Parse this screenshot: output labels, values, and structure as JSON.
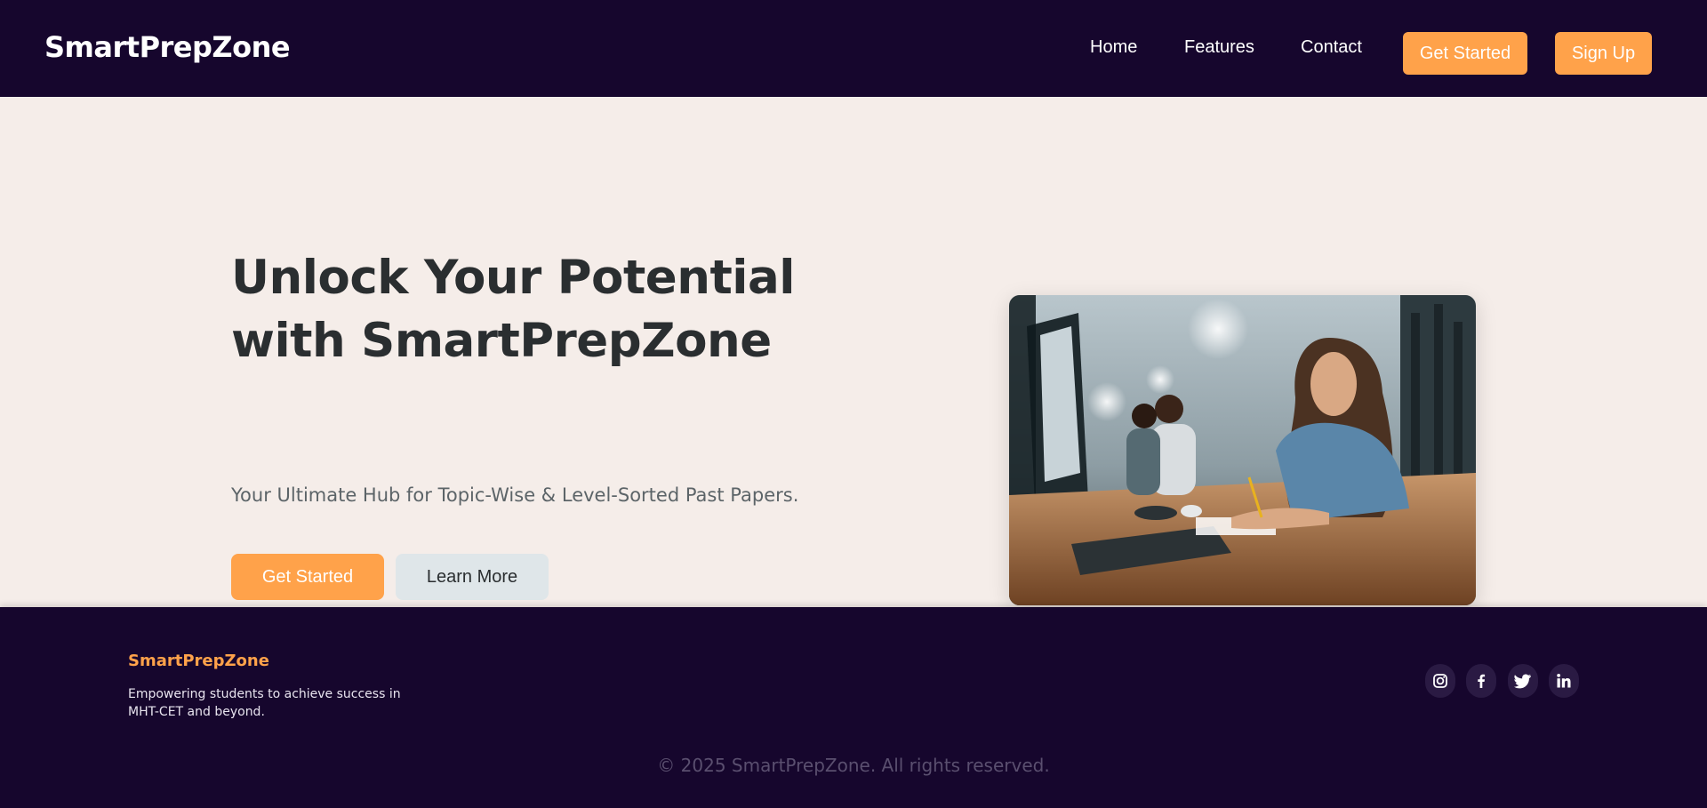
{
  "navbar": {
    "brand": "SmartPrepZone",
    "links": [
      "Home",
      "Features",
      "Contact"
    ],
    "get_started_label": "Get Started",
    "sign_up_label": "Sign Up"
  },
  "hero": {
    "title": "Unlock Your Potential with SmartPrepZone",
    "subtitle": "Your Ultimate Hub for Topic-Wise & Level-Sorted Past Papers.",
    "primary_label": "Get Started",
    "secondary_label": "Learn More",
    "image_icon": "students-studying-photo"
  },
  "footer": {
    "brand": "SmartPrepZone",
    "tagline": "Empowering students to achieve success in MHT-CET and beyond.",
    "social_icons": [
      "instagram-icon",
      "facebook-icon",
      "twitter-icon",
      "linkedin-icon"
    ],
    "copyright": "© 2025 SmartPrepZone. All rights reserved."
  },
  "colors": {
    "navy": "#16062d",
    "accent": "#ffa24a",
    "background": "#f5ede9",
    "heading": "#2a2e30",
    "secondary_button": "#dfe6e9"
  }
}
